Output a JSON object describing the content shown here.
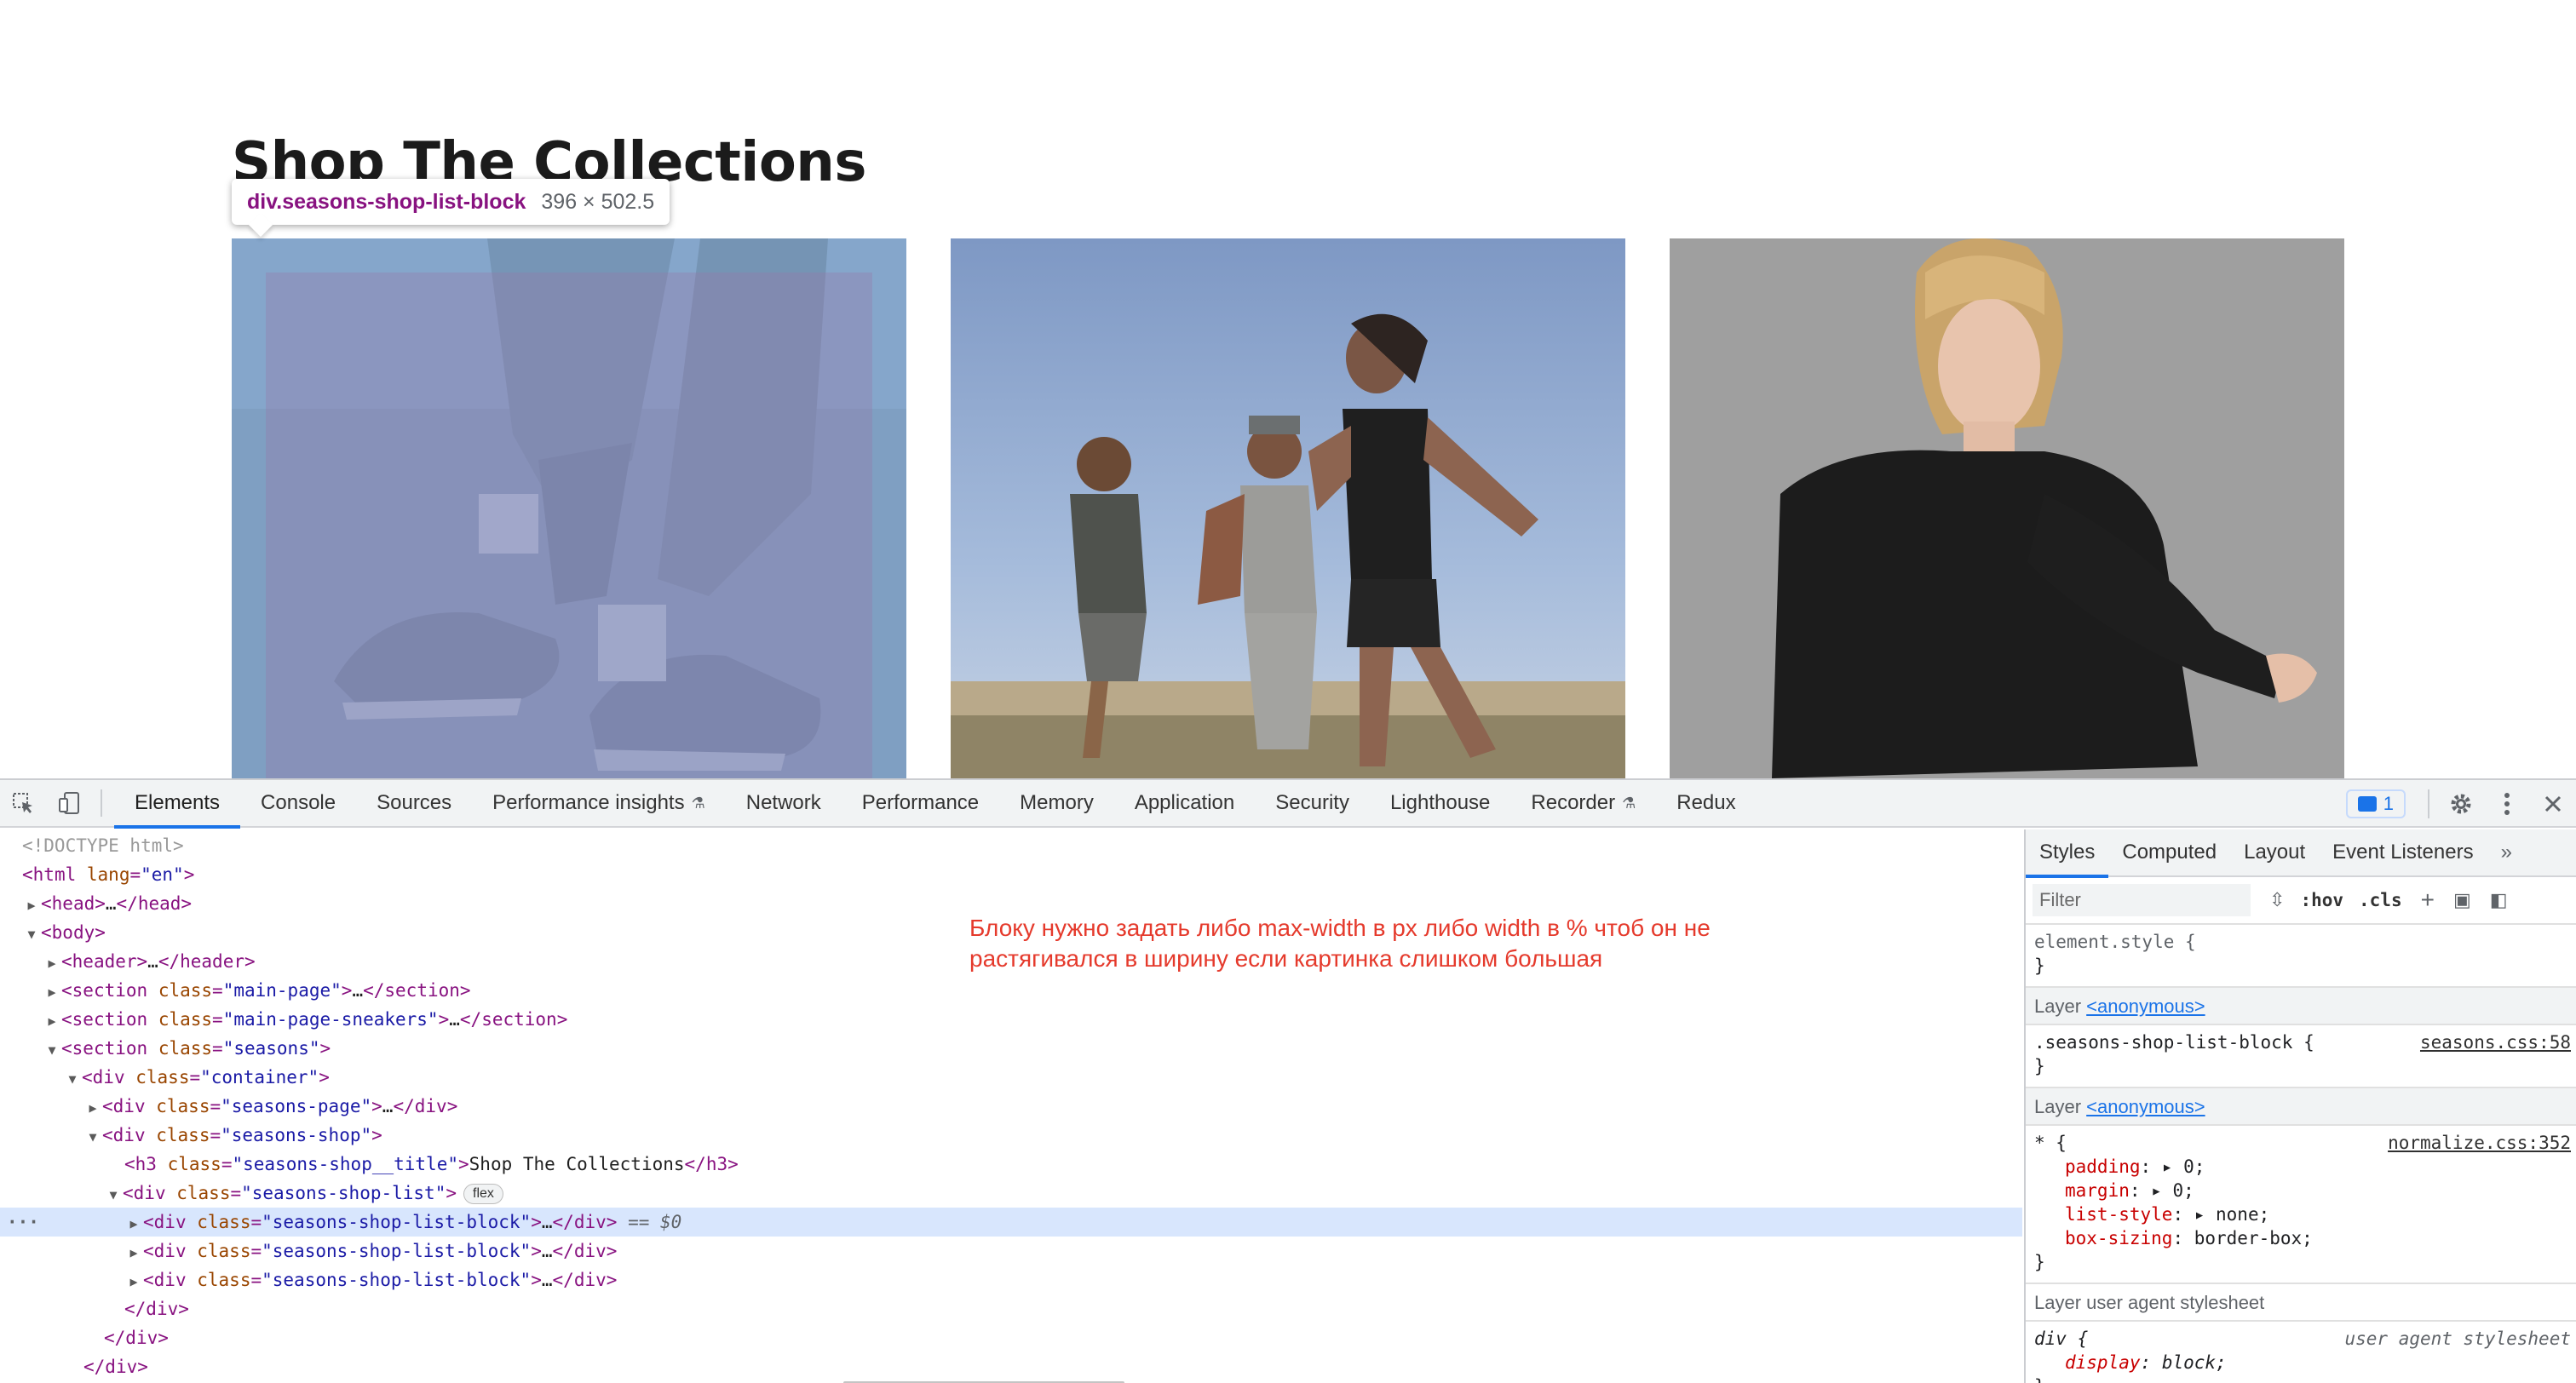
{
  "page": {
    "title": "Shop The Collections",
    "tooltip": {
      "tag": "div.seasons-shop-list-block",
      "size": "396 × 502.5"
    },
    "cards": [
      {
        "name": "sneakers-image"
      },
      {
        "name": "runners-image"
      },
      {
        "name": "black-shirt-image"
      }
    ]
  },
  "devtools": {
    "toolbar": {
      "inspect_icon": "cursor-select-icon",
      "device_icon": "device-toggle-icon",
      "tabs": [
        "Elements",
        "Console",
        "Sources",
        "Performance insights",
        "Network",
        "Performance",
        "Memory",
        "Application",
        "Security",
        "Lighthouse",
        "Recorder",
        "Redux"
      ],
      "active_tab": "Elements",
      "issues_count": "1"
    },
    "dom": {
      "doctype": "<!DOCTYPE html>",
      "html_tag": "html",
      "html_attr": "lang",
      "html_val": "\"en\"",
      "head": "head",
      "body": "body",
      "header": "header",
      "section": "section",
      "div": "div",
      "h3": "h3",
      "class": "class",
      "main_page": "\"main-page\"",
      "main_page_sneakers": "\"main-page-sneakers\"",
      "seasons": "\"seasons\"",
      "container": "\"container\"",
      "seasons_page": "\"seasons-page\"",
      "seasons_shop": "\"seasons-shop\"",
      "seasons_shop_title": "\"seasons-shop__title\"",
      "title_text": "Shop The Collections",
      "seasons_shop_list": "\"seasons-shop-list\"",
      "flex_badge": "flex",
      "list_block": "\"seasons-shop-list-block\"",
      "selected_marker": "== $0",
      "ellipsis": "…"
    },
    "note": "Блоку нужно задать либо max-width в px либо width в % чтоб он не растягивался в ширину если картинка слишком большая",
    "styles": {
      "tabs": [
        "Styles",
        "Computed",
        "Layout",
        "Event Listeners"
      ],
      "active_tab": "Styles",
      "filter_placeholder": "Filter",
      "hov": ":hov",
      "cls": ".cls",
      "element_style": "element.style {",
      "close_brace": "}",
      "layer_label": "Layer",
      "layer_anon": "<anonymous>",
      "rule1_selector": ".seasons-shop-list-block {",
      "rule1_source": "seasons.css:58",
      "rule2_selector": "* {",
      "rule2_source": "normalize.css:352",
      "decls": [
        {
          "name": "padding",
          "value": "0;"
        },
        {
          "name": "margin",
          "value": "0;"
        },
        {
          "name": "list-style",
          "value": "none;"
        },
        {
          "name": "box-sizing",
          "value": "border-box;"
        }
      ],
      "ua_layer": "Layer user agent stylesheet",
      "ua_selector": "div {",
      "ua_source": "user agent stylesheet",
      "ua_decl_name": "display",
      "ua_decl_value": "block;"
    }
  }
}
